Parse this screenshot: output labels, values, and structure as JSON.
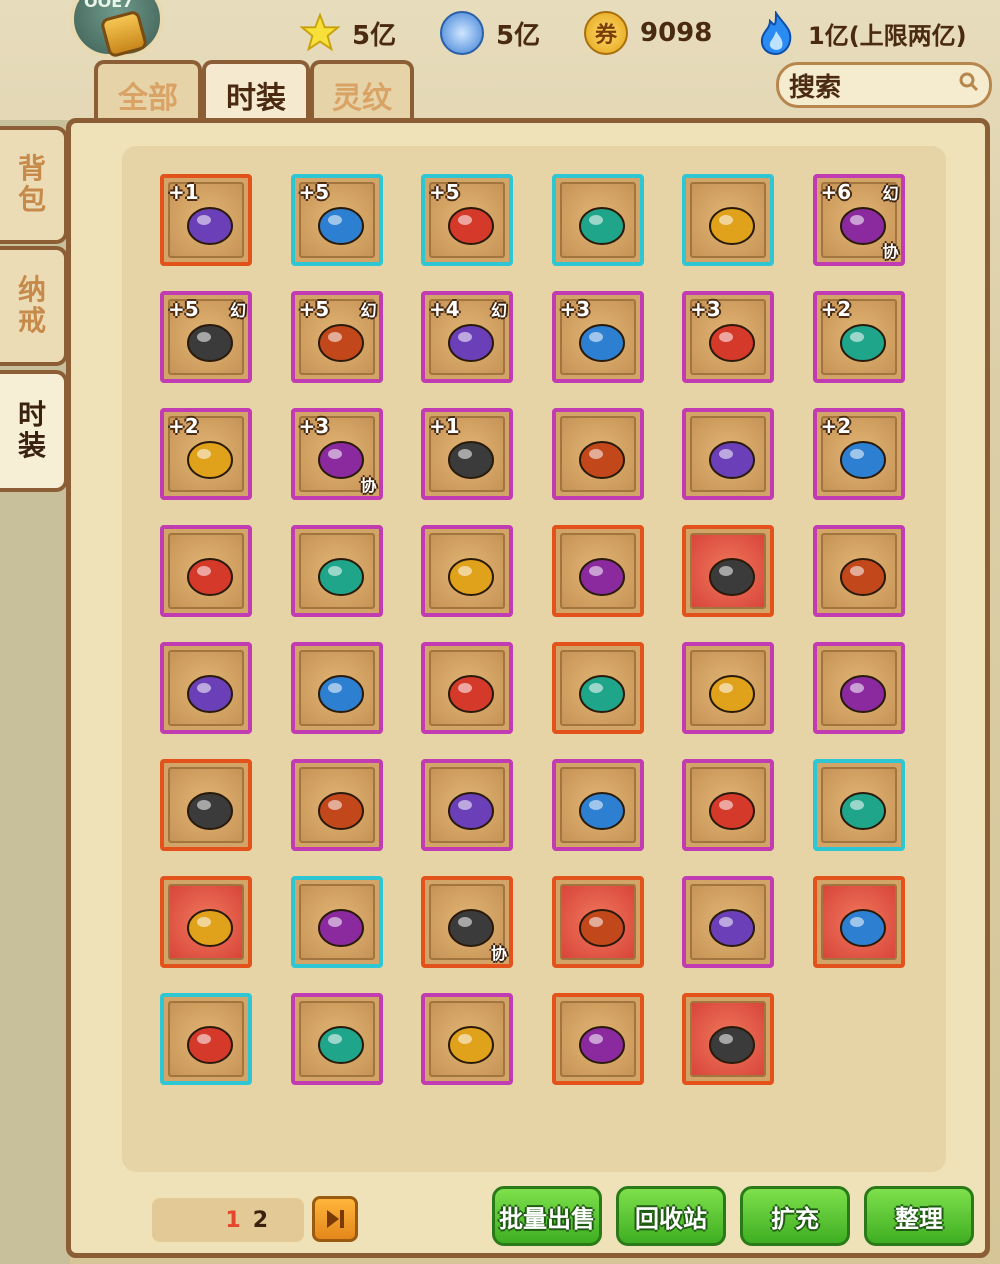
{
  "currencies": [
    {
      "icon": "star-coin-icon",
      "value": "5亿"
    },
    {
      "icon": "swirl-orb-icon",
      "value": "5亿"
    },
    {
      "icon": "ticket-coin-icon",
      "glyph": "券",
      "value": "9098"
    },
    {
      "icon": "blue-flame-icon",
      "value": "1亿(上限两亿)"
    }
  ],
  "top_tabs": [
    "全部",
    "时装",
    "灵纹"
  ],
  "active_top_tab": 1,
  "search": {
    "label": "搜索"
  },
  "side_tabs": [
    "背包",
    "纳戒",
    "时装"
  ],
  "active_side_tab": 2,
  "items": [
    {
      "plus": "+1",
      "border": "orange",
      "tr": "",
      "br": "",
      "icon": "staff-icon"
    },
    {
      "plus": "+5",
      "border": "cyan",
      "tr": "",
      "br": "",
      "icon": "fox-outfit-icon"
    },
    {
      "plus": "+5",
      "border": "cyan",
      "tr": "",
      "br": "",
      "icon": "butterfly-wings-icon"
    },
    {
      "plus": "",
      "border": "cyan",
      "tr": "",
      "br": "",
      "icon": "crystal-spear-icon"
    },
    {
      "plus": "",
      "border": "cyan",
      "tr": "",
      "br": "",
      "icon": "ice-helmet-icon"
    },
    {
      "plus": "+6",
      "border": "purple",
      "tr": "幻",
      "br": "协",
      "icon": "bat-staff-icon"
    },
    {
      "plus": "+5",
      "border": "purple",
      "tr": "幻",
      "br": "",
      "icon": "shark-hat-icon"
    },
    {
      "plus": "+5",
      "border": "purple",
      "tr": "幻",
      "br": "",
      "icon": "dark-wings-icon"
    },
    {
      "plus": "+4",
      "border": "purple",
      "tr": "幻",
      "br": "",
      "icon": "candied-haws-icon"
    },
    {
      "plus": "+3",
      "border": "purple",
      "tr": "",
      "br": "",
      "icon": "dragon-mask-icon"
    },
    {
      "plus": "+3",
      "border": "purple",
      "tr": "",
      "br": "",
      "icon": "red-flute-icon"
    },
    {
      "plus": "+2",
      "border": "purple",
      "tr": "",
      "br": "",
      "icon": "grad-cap-icon"
    },
    {
      "plus": "+2",
      "border": "purple",
      "tr": "",
      "br": "",
      "icon": "fox-mask-icon"
    },
    {
      "plus": "+3",
      "border": "purple",
      "tr": "",
      "br": "协",
      "icon": "penguin-icon"
    },
    {
      "plus": "+1",
      "border": "purple",
      "tr": "",
      "br": "",
      "icon": "flower-wand-icon"
    },
    {
      "plus": "",
      "border": "purple",
      "tr": "",
      "br": "",
      "icon": "trident-icon"
    },
    {
      "plus": "",
      "border": "purple",
      "tr": "",
      "br": "",
      "icon": "bone-icon"
    },
    {
      "plus": "+2",
      "border": "purple",
      "tr": "",
      "br": "",
      "icon": "chicken-hat-icon"
    },
    {
      "plus": "",
      "border": "purple",
      "tr": "",
      "br": "",
      "icon": "white-coat-icon"
    },
    {
      "plus": "",
      "border": "purple",
      "tr": "",
      "br": "",
      "icon": "hooded-cloak-icon"
    },
    {
      "plus": "",
      "border": "purple",
      "tr": "",
      "br": "",
      "icon": "brush-icon"
    },
    {
      "plus": "",
      "border": "orange",
      "tr": "",
      "br": "",
      "icon": "green-staff-icon"
    },
    {
      "plus": "",
      "border": "orange",
      "tr": "",
      "br": "",
      "icon": "snorkel-icon",
      "redbg": true
    },
    {
      "plus": "",
      "border": "purple",
      "tr": "",
      "br": "",
      "icon": "cat-helmet-icon"
    },
    {
      "plus": "",
      "border": "purple",
      "tr": "",
      "br": "",
      "icon": "phoenix-wings-icon"
    },
    {
      "plus": "",
      "border": "purple",
      "tr": "",
      "br": "",
      "icon": "bone-icon"
    },
    {
      "plus": "",
      "border": "purple",
      "tr": "",
      "br": "",
      "icon": "hammer-icon"
    },
    {
      "plus": "",
      "border": "orange",
      "tr": "",
      "br": "",
      "icon": "lion-mask-icon"
    },
    {
      "plus": "",
      "border": "purple",
      "tr": "",
      "br": "",
      "icon": "festive-cloak-icon"
    },
    {
      "plus": "",
      "border": "purple",
      "tr": "",
      "br": "",
      "icon": "ornate-staff-icon"
    },
    {
      "plus": "",
      "border": "orange",
      "tr": "",
      "br": "",
      "icon": "taiji-disc-icon"
    },
    {
      "plus": "",
      "border": "purple",
      "tr": "",
      "br": "",
      "icon": "tiger-hood-icon"
    },
    {
      "plus": "",
      "border": "purple",
      "tr": "",
      "br": "",
      "icon": "angel-wings-icon"
    },
    {
      "plus": "",
      "border": "purple",
      "tr": "",
      "br": "",
      "icon": "dark-wings-icon"
    },
    {
      "plus": "",
      "border": "purple",
      "tr": "",
      "br": "",
      "icon": "candied-haws-icon"
    },
    {
      "plus": "",
      "border": "cyan",
      "tr": "",
      "br": "",
      "icon": "golden-spear-icon"
    },
    {
      "plus": "",
      "border": "orange",
      "tr": "",
      "br": "",
      "icon": "flame-wings-icon",
      "redbg": true
    },
    {
      "plus": "",
      "border": "cyan",
      "tr": "",
      "br": "",
      "icon": "armor-icon"
    },
    {
      "plus": "",
      "border": "orange",
      "tr": "",
      "br": "协",
      "icon": "sun-emblem-icon"
    },
    {
      "plus": "",
      "border": "orange",
      "tr": "",
      "br": "",
      "icon": "antler-hat-icon",
      "redbg": true
    },
    {
      "plus": "",
      "border": "purple",
      "tr": "",
      "br": "",
      "icon": "grad-cap-icon"
    },
    {
      "plus": "",
      "border": "orange",
      "tr": "",
      "br": "",
      "icon": "lion-head-icon",
      "redbg": true
    },
    {
      "plus": "",
      "border": "cyan",
      "tr": "",
      "br": "",
      "icon": "gold-wings-icon"
    },
    {
      "plus": "",
      "border": "purple",
      "tr": "",
      "br": "",
      "icon": "red-dragon-hat-icon"
    },
    {
      "plus": "",
      "border": "purple",
      "tr": "",
      "br": "",
      "icon": "firecracker-staff-icon"
    },
    {
      "plus": "",
      "border": "orange",
      "tr": "",
      "br": "",
      "icon": "bat-wings-icon"
    },
    {
      "plus": "",
      "border": "orange",
      "tr": "",
      "br": "",
      "icon": "gold-coin-icon",
      "redbg": true
    }
  ],
  "pager": {
    "current": "1",
    "total": "2"
  },
  "buttons": {
    "bulk_sell": "批量出售",
    "recycle": "回收站",
    "expand": "扩充",
    "sort": "整理"
  }
}
